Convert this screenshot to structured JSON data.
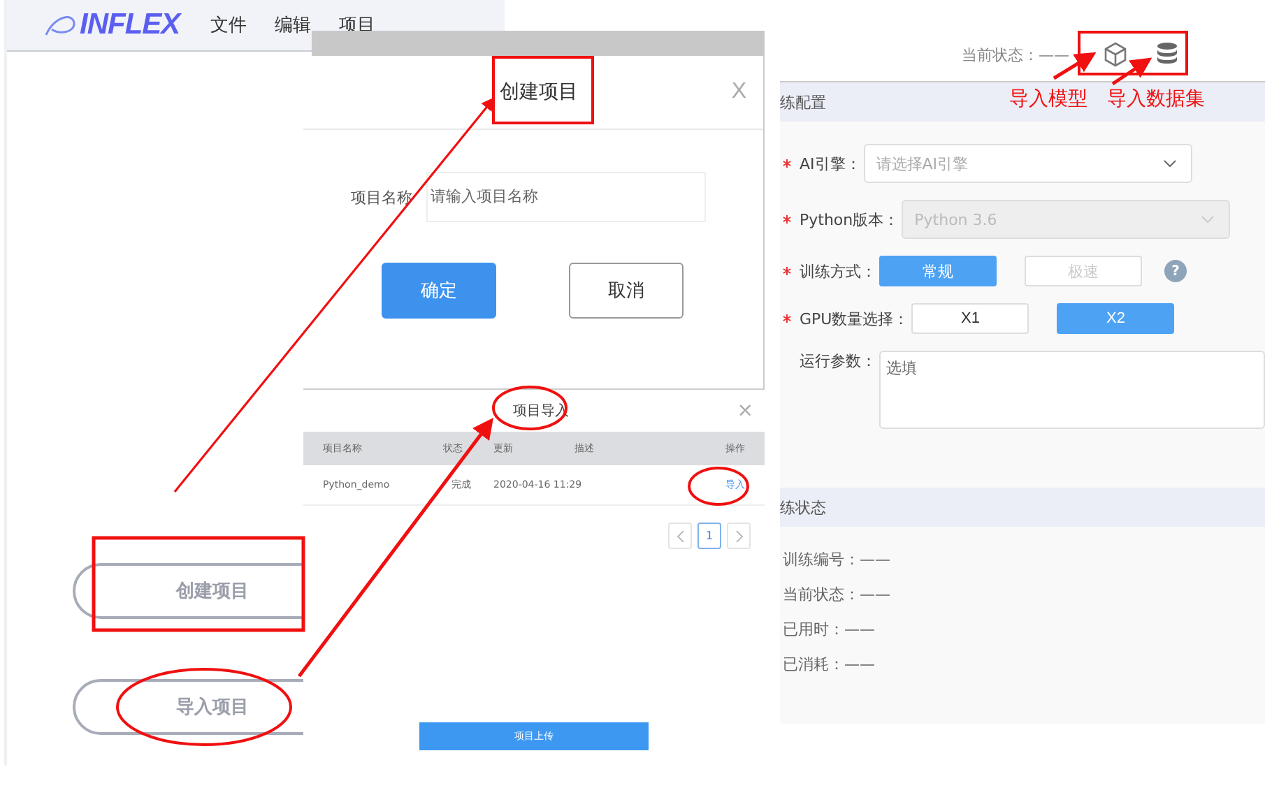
{
  "main_window": {
    "logo": "INFLEX",
    "menu": [
      "文件",
      "编辑",
      "项目"
    ],
    "buttons": [
      "创建项目",
      "导入项目"
    ]
  },
  "create_dialog": {
    "title": "创建项目",
    "close": "X",
    "field_label": "项目名称",
    "placeholder": "请输入项目名称",
    "buttons": [
      {
        "label": "确定",
        "kind": "primary"
      },
      {
        "label": "取消",
        "kind": "default"
      }
    ]
  },
  "import_dialog": {
    "title": "项目导入",
    "close": "×",
    "columns": [
      "项目名称",
      "状态",
      "更新",
      "描述",
      "操作"
    ],
    "rows": [
      {
        "cells": [
          "Python_demo",
          "完成",
          "2020-04-16 11:29",
          ""
        ],
        "action": "导入"
      }
    ],
    "pagination": [
      {
        "label": "1",
        "selected": true
      }
    ],
    "upload_button": "项目上传"
  },
  "training_panel": {
    "status": "当前状态：——",
    "config_title": "练配置",
    "fields": [
      {
        "kind": "select",
        "label": "AI引擎：",
        "required": true,
        "value": "请选择AI引擎",
        "disabled": false
      },
      {
        "kind": "select",
        "label": "Python版本：",
        "required": true,
        "value": "Python 3.6",
        "disabled": true
      },
      {
        "kind": "options",
        "label": "训练方式：",
        "required": true,
        "help": "?",
        "options": [
          {
            "label": "常规",
            "selected": true,
            "disabled": false
          },
          {
            "label": "极速",
            "selected": false,
            "disabled": true
          }
        ]
      },
      {
        "kind": "options",
        "label": "GPU数量选择：",
        "required": true,
        "options": [
          {
            "label": "X1",
            "selected": false,
            "disabled": false
          },
          {
            "label": "X2",
            "selected": true,
            "disabled": false
          }
        ]
      },
      {
        "kind": "textarea",
        "label": "运行参数：",
        "required": false,
        "placeholder": "选填"
      }
    ],
    "status_title": "练状态",
    "status_items": [
      "训练编号：——",
      "当前状态：——",
      "已用时：——",
      "已消耗：——"
    ]
  },
  "annotations": [
    "导入模型",
    "导入数据集"
  ]
}
